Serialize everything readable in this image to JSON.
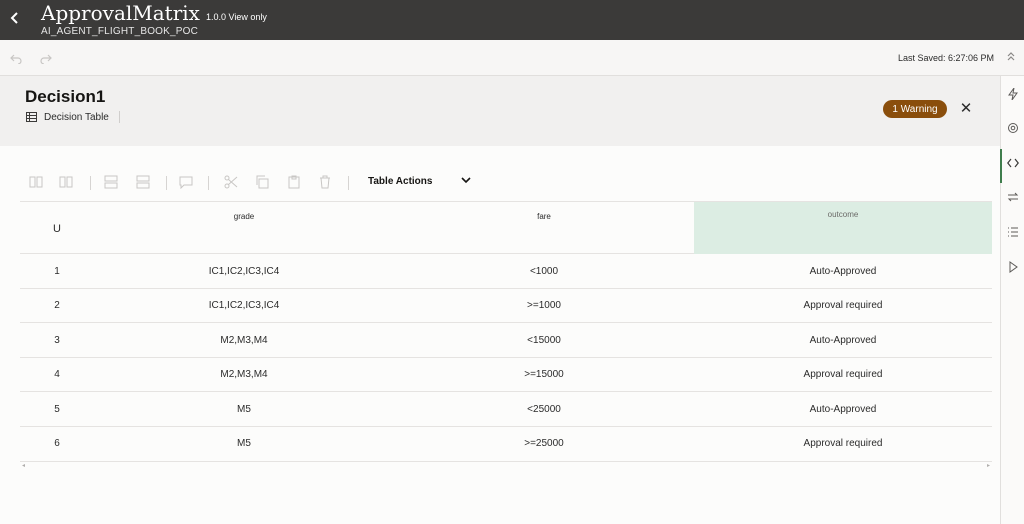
{
  "app": {
    "title": "ApprovalMatrix",
    "version": "1.0.0 View only",
    "subtitle": "AI_AGENT_FLIGHT_BOOK_POC"
  },
  "subbar": {
    "last_saved": "Last Saved: 6:27:06 PM"
  },
  "header": {
    "title": "Decision1",
    "type": "Decision Table",
    "warning": "1 Warning",
    "close": "✕"
  },
  "toolbar": {
    "table_actions": "Table Actions"
  },
  "table": {
    "columns": {
      "u": "U",
      "grade": "grade",
      "fare": "fare",
      "outcome": "outcome"
    },
    "rows": [
      {
        "u": "1",
        "grade": "IC1,IC2,IC3,IC4",
        "fare": "<1000",
        "outcome": "Auto-Approved"
      },
      {
        "u": "2",
        "grade": "IC1,IC2,IC3,IC4",
        "fare": ">=1000",
        "outcome": "Approval required"
      },
      {
        "u": "3",
        "grade": "M2,M3,M4",
        "fare": "<15000",
        "outcome": "Auto-Approved"
      },
      {
        "u": "4",
        "grade": "M2,M3,M4",
        "fare": ">=15000",
        "outcome": "Approval required"
      },
      {
        "u": "5",
        "grade": "M5",
        "fare": "<25000",
        "outcome": "Auto-Approved"
      },
      {
        "u": "6",
        "grade": "M5",
        "fare": ">=25000",
        "outcome": "Approval required"
      }
    ]
  },
  "colors": {
    "appbar": "#3b3a39",
    "warning": "#8a4e0c",
    "outcome_header": "#dcede3",
    "rail_active": "#3f7d4d"
  },
  "icons": {
    "back": "chevron-left-icon",
    "undo": "undo-icon",
    "redo": "redo-icon",
    "collapse": "chevron-double-up-icon",
    "table": "table-icon",
    "close": "close-icon",
    "rail": [
      "lightning-icon",
      "gear-icon",
      "code-icon",
      "swap-icon",
      "list-icon",
      "play-icon"
    ]
  }
}
